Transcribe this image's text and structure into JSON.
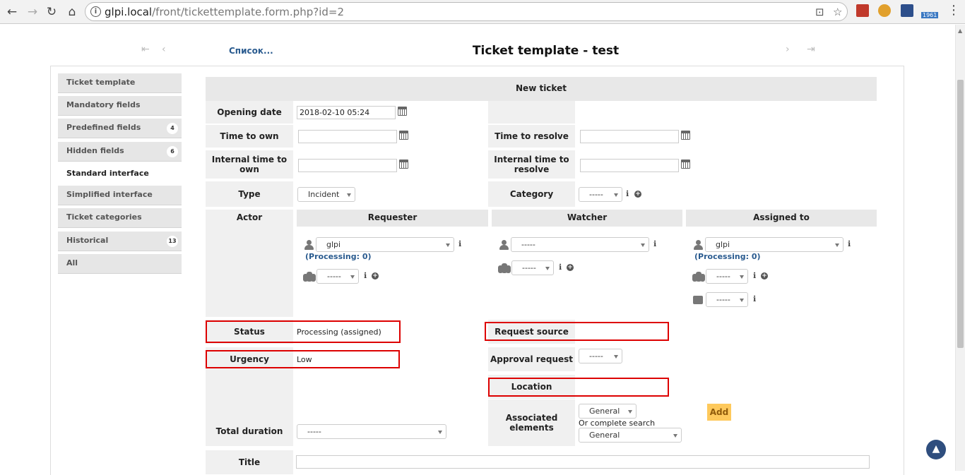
{
  "browser": {
    "url_host": "glpi.local",
    "url_path": "/front/tickettemplate.form.php?id=2",
    "ext_badge": "1961"
  },
  "header": {
    "list_link": "Список...",
    "title": "Ticket template - test"
  },
  "sidebar": {
    "items": [
      {
        "label": "Ticket template",
        "badge": ""
      },
      {
        "label": "Mandatory fields",
        "badge": ""
      },
      {
        "label": "Predefined fields",
        "badge": "4"
      },
      {
        "label": "Hidden fields",
        "badge": "6"
      },
      {
        "label": "Standard interface",
        "badge": ""
      },
      {
        "label": "Simplified interface",
        "badge": ""
      },
      {
        "label": "Ticket categories",
        "badge": ""
      },
      {
        "label": "Historical",
        "badge": "13"
      },
      {
        "label": "All",
        "badge": ""
      }
    ]
  },
  "form": {
    "section_title": "New ticket",
    "opening_date_label": "Opening date",
    "opening_date_value": "2018-02-10 05:24",
    "time_to_own_label": "Time to own",
    "time_to_resolve_label": "Time to resolve",
    "internal_tto_label": "Internal time to own",
    "internal_ttr_label": "Internal time to resolve",
    "type_label": "Type",
    "type_value": "Incident",
    "category_label": "Category",
    "category_value": "-----",
    "actor_label": "Actor",
    "requester_label": "Requester",
    "watcher_label": "Watcher",
    "assigned_label": "Assigned to",
    "requester_user": "glpi",
    "requester_processing": "(Processing: 0)",
    "requester_group": "-----",
    "watcher_user": "-----",
    "watcher_group": "-----",
    "assigned_user": "glpi",
    "assigned_processing": "(Processing: 0)",
    "assigned_group": "-----",
    "assigned_supplier": "-----",
    "status_label": "Status",
    "status_value": "Processing (assigned)",
    "request_source_label": "Request source",
    "urgency_label": "Urgency",
    "urgency_value": "Low",
    "approval_label": "Approval request",
    "approval_value": "-----",
    "location_label": "Location",
    "assoc_label": "Associated elements",
    "assoc_type": "General",
    "assoc_search_text": "Or complete search",
    "assoc_item": "General",
    "add_label": "Add",
    "total_duration_label": "Total duration",
    "total_duration_value": "-----",
    "title_label": "Title"
  },
  "colors": {
    "highlight_border": "#dd0000",
    "link": "#2a5b8f",
    "add_button": "#fec95c"
  }
}
